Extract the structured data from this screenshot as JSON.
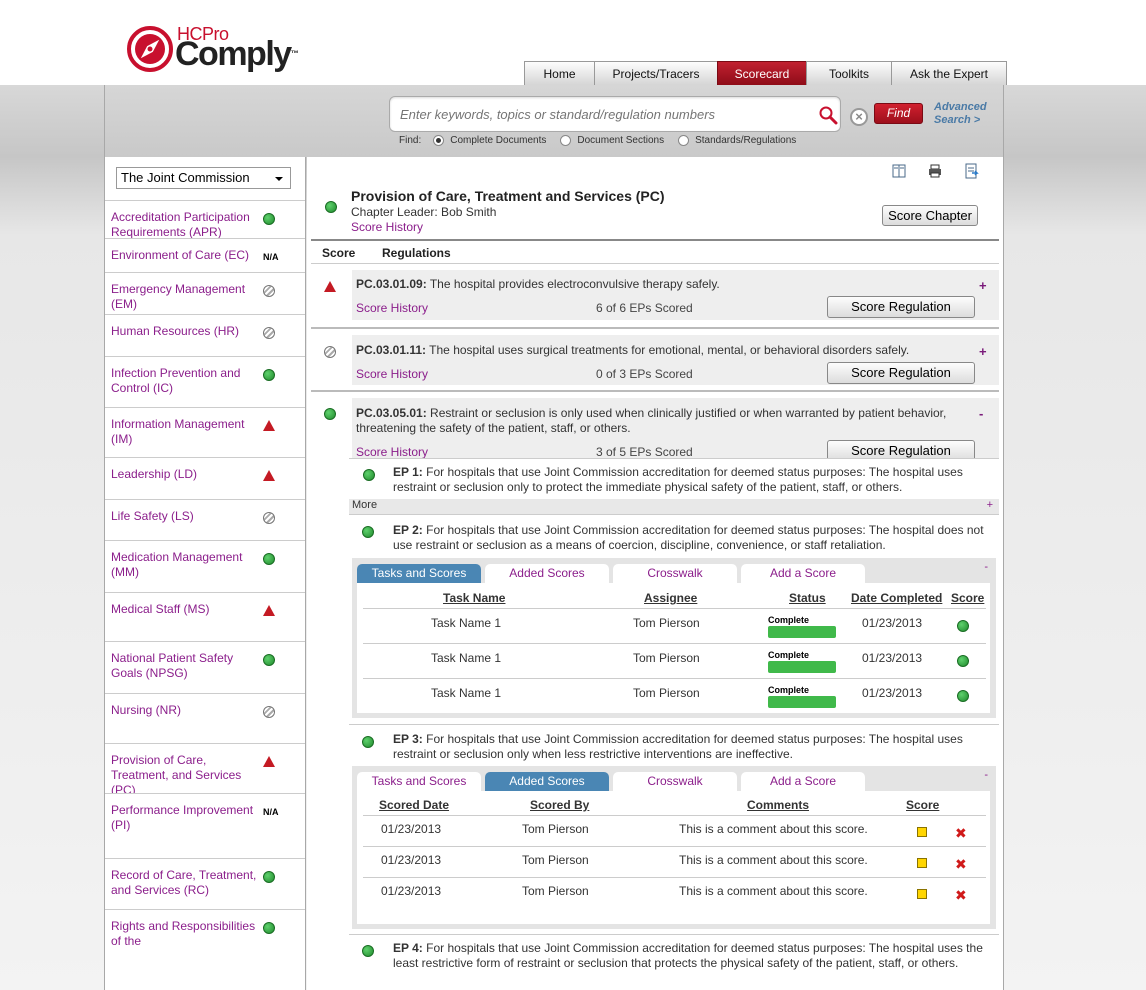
{
  "logo": {
    "brand": "HCPro",
    "product": "Comply",
    "tm": "™"
  },
  "nav": {
    "tabs": [
      {
        "label": "Home",
        "active": false
      },
      {
        "label": "Projects/Tracers",
        "active": false
      },
      {
        "label": "Scorecard",
        "active": true
      },
      {
        "label": "Toolkits",
        "active": false
      },
      {
        "label": "Ask the Expert",
        "active": false
      }
    ]
  },
  "search": {
    "placeholder": "Enter keywords, topics or standard/regulation numbers",
    "find_label": "Find",
    "advanced_label": "Advanced Search >",
    "find_prefix": "Find:",
    "options": [
      {
        "label": "Complete Documents",
        "selected": true
      },
      {
        "label": "Document Sections",
        "selected": false
      },
      {
        "label": "Standards/Regulations",
        "selected": false
      }
    ]
  },
  "sidebar": {
    "selected_org": "The Joint Commission",
    "items": [
      {
        "label": "Accreditation Participation Requirements (APR)",
        "status": "compliant"
      },
      {
        "label": "Environment of Care (EC)",
        "status": "na",
        "status_text": "N/A"
      },
      {
        "label": "Emergency Management (EM)",
        "status": "not-scored"
      },
      {
        "label": "Human Resources (HR)",
        "status": "not-scored"
      },
      {
        "label": "Infection Prevention and Control (IC)",
        "status": "compliant"
      },
      {
        "label": "Information Management (IM)",
        "status": "warning"
      },
      {
        "label": "Leadership (LD)",
        "status": "warning"
      },
      {
        "label": "Life Safety (LS)",
        "status": "not-scored"
      },
      {
        "label": "Medication Management (MM)",
        "status": "compliant"
      },
      {
        "label": "Medical Staff (MS)",
        "status": "warning"
      },
      {
        "label": "National Patient Safety Goals (NPSG)",
        "status": "compliant"
      },
      {
        "label": "Nursing (NR)",
        "status": "not-scored"
      },
      {
        "label": "Provision of Care, Treatment, and Services (PC)",
        "status": "warning"
      },
      {
        "label": "Performance Improvement (PI)",
        "status": "na",
        "status_text": "N/A"
      },
      {
        "label": "Record of Care, Treatment, and Services (RC)",
        "status": "compliant"
      },
      {
        "label": "Rights and Responsibilities of the",
        "status": "compliant"
      }
    ]
  },
  "chapter": {
    "title": "Provision of Care, Treatment and Services (PC)",
    "leader": "Chapter Leader: Bob Smith",
    "history": "Score History",
    "score_button": "Score Chapter",
    "col_score": "Score",
    "col_regs": "Regulations"
  },
  "regulations": [
    {
      "code": "PC.03.01.09:",
      "text": " The hospital provides electroconvulsive therapy safely.",
      "history": "Score History",
      "count": "6 of 6 EPs Scored",
      "button": "Score Regulation",
      "toggle": "+",
      "status": "warning"
    },
    {
      "code": "PC.03.01.11:",
      "text": " The hospital uses surgical treatments for emotional, mental, or behavioral disorders safely.",
      "history": "Score History",
      "count": "0 of 3 EPs Scored",
      "button": "Score Regulation",
      "toggle": "+",
      "status": "not-scored"
    },
    {
      "code": "PC.03.05.01:",
      "text": " Restraint or seclusion is only used when clinically justified or when warranted by patient behavior, threatening the safety of the patient, staff, or others.",
      "history": "Score History",
      "count": "3 of 5 EPs Scored",
      "button": "Score Regulation",
      "toggle": "-",
      "status": "compliant"
    }
  ],
  "eps": [
    {
      "code": "EP 1:",
      "text": " For hospitals that use Joint Commission accreditation for deemed status purposes: The hospital uses restraint or seclusion only to protect the immediate physical safety of the patient, staff, or others."
    },
    {
      "code": "EP 2:",
      "text": " For hospitals that use Joint Commission accreditation for deemed status purposes: The hospital does not use restraint or seclusion as a means of coercion, discipline, convenience, or staff retaliation."
    },
    {
      "code": "EP 3:",
      "text": " For hospitals that use Joint Commission accreditation for deemed status purposes: The hospital uses restraint or seclusion only when less restrictive interventions are ineffective."
    },
    {
      "code": "EP 4:",
      "text": " For hospitals that use Joint Commission accreditation for deemed status purposes: The hospital uses the least restrictive form of restraint or seclusion that protects the physical safety of the patient, staff, or others."
    }
  ],
  "more": {
    "label": "More",
    "toggle": "+"
  },
  "panel_tabs": [
    "Tasks and Scores",
    "Added Scores",
    "Crosswalk",
    "Add a Score"
  ],
  "panel_toggle": "-",
  "tasks": {
    "headers": [
      "Task Name",
      "Assignee",
      "Status",
      "Date Completed",
      "Score"
    ],
    "rows": [
      {
        "name": "Task Name 1",
        "assignee": "Tom Pierson",
        "status": "Complete",
        "progress": 1.0,
        "date": "01/23/2013"
      },
      {
        "name": "Task Name 1",
        "assignee": "Tom Pierson",
        "status": "Complete",
        "progress": 1.0,
        "date": "01/23/2013"
      },
      {
        "name": "Task Name 1",
        "assignee": "Tom Pierson",
        "status": "Complete",
        "progress": 1.0,
        "date": "01/23/2013"
      }
    ]
  },
  "scores": {
    "headers": [
      "Scored Date",
      "Scored By",
      "Comments",
      "Score"
    ],
    "rows": [
      {
        "date": "01/23/2013",
        "by": "Tom Pierson",
        "comment": "This is a comment about this score."
      },
      {
        "date": "01/23/2013",
        "by": "Tom Pierson",
        "comment": "This is a comment about this score."
      },
      {
        "date": "01/23/2013",
        "by": "Tom Pierson",
        "comment": "This is a comment about this score."
      }
    ]
  },
  "colors": {
    "brand_red": "#c8102e",
    "link_purple": "#8b1e8b",
    "tab_blue": "#4a86b4",
    "status_green": "#40b94a"
  }
}
